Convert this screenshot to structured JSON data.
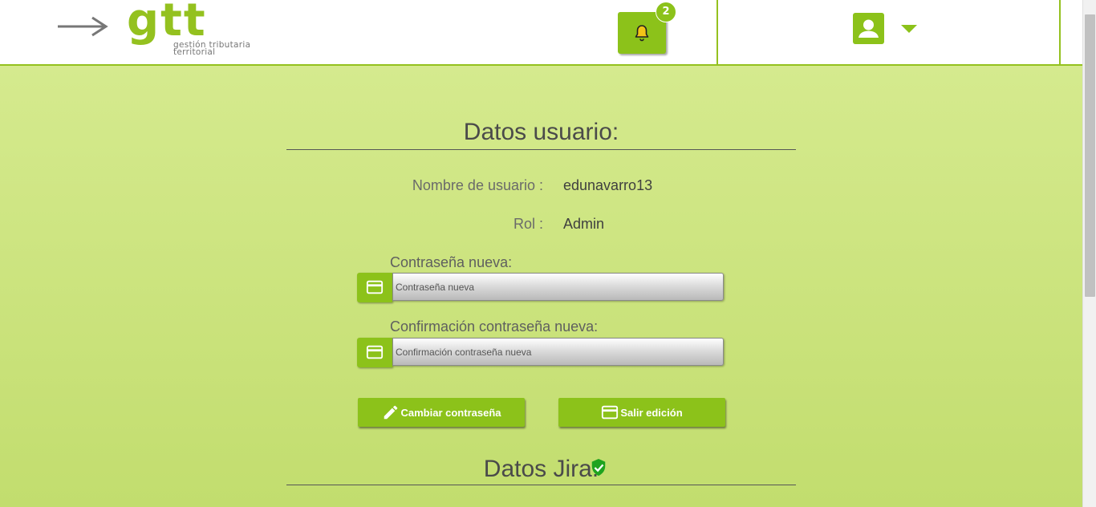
{
  "header": {
    "logo_text": "gtt",
    "logo_subtitle_1": "gestión tributaria",
    "logo_subtitle_2": "territorial",
    "notification_count": "2"
  },
  "colors": {
    "accent": "#8cc21a",
    "background_top": "#d5ea8e",
    "background_bottom": "#c2dd6e",
    "text_dark": "#4a4a4a"
  },
  "icons": {
    "back": "arrow-right-icon",
    "notifications": "bell-icon",
    "user": "account-box-icon",
    "menu": "caret-down-icon",
    "field": "credit-card-icon",
    "edit": "pencil-icon",
    "exit": "credit-card-icon",
    "verified": "shield-check-icon"
  },
  "user_section": {
    "title": "Datos usuario:",
    "username_label": "Nombre de usuario :",
    "username_value": "edunavarro13",
    "role_label": "Rol :",
    "role_value": "Admin",
    "new_password_label": "Contraseña nueva:",
    "new_password_placeholder": "Contraseña nueva",
    "confirm_password_label": "Confirmación contraseña nueva:",
    "confirm_password_placeholder": "Confirmación contraseña nueva",
    "change_password_button": "Cambiar contraseña",
    "exit_edit_button": "Salir edición"
  },
  "jira_section": {
    "title": "Datos Jira:"
  }
}
